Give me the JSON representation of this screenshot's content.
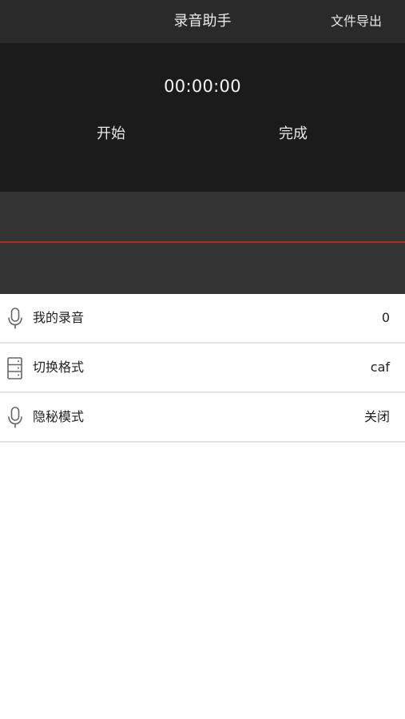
{
  "navbar": {
    "title": "录音助手",
    "export_label": "文件导出"
  },
  "recorder": {
    "timer": "00:00:00",
    "start_label": "开始",
    "finish_label": "完成",
    "waveform_color": "#b02a2a"
  },
  "settings": {
    "items": [
      {
        "icon": "microphone-icon",
        "label": "我的录音",
        "value": "0"
      },
      {
        "icon": "format-icon",
        "label": "切换格式",
        "value": "caf"
      },
      {
        "icon": "microphone-icon",
        "label": "隐秘模式",
        "value": "关闭"
      }
    ]
  },
  "colors": {
    "navbar_bg": "#2a2a2a",
    "panel_bg": "#1b1b1b",
    "wave_bg": "#333333"
  }
}
